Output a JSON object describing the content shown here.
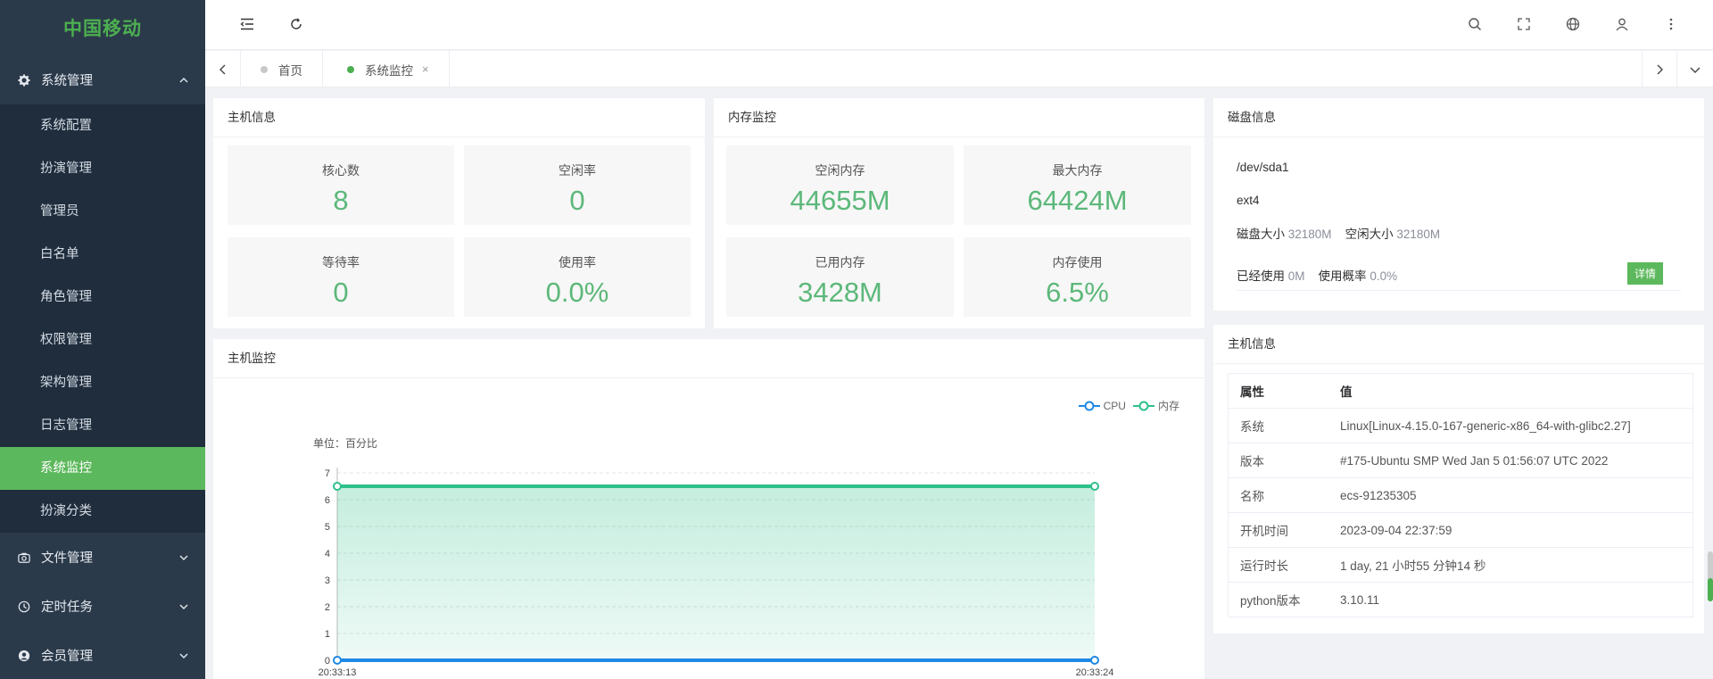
{
  "brand": {
    "logo_text": "中国移动",
    "accent": "#5cb85c",
    "sidebar_bg": "#1f2d3d"
  },
  "sidebar": {
    "groups": [
      {
        "label": "系统管理",
        "icon": "gear-icon",
        "expanded": true,
        "items": [
          {
            "label": "系统配置"
          },
          {
            "label": "扮演管理"
          },
          {
            "label": "管理员"
          },
          {
            "label": "白名单"
          },
          {
            "label": "角色管理"
          },
          {
            "label": "权限管理"
          },
          {
            "label": "架构管理"
          },
          {
            "label": "日志管理"
          },
          {
            "label": "系统监控",
            "active": true
          },
          {
            "label": "扮演分类"
          }
        ]
      },
      {
        "label": "文件管理",
        "icon": "camera-icon",
        "expanded": false
      },
      {
        "label": "定时任务",
        "icon": "clock-icon",
        "expanded": false
      },
      {
        "label": "会员管理",
        "icon": "user-circle-icon",
        "expanded": false
      }
    ]
  },
  "header": {
    "icons": [
      "menu-fold-icon",
      "refresh-icon",
      "search-icon",
      "fullscreen-icon",
      "globe-icon",
      "user-icon",
      "more-vertical-icon"
    ]
  },
  "tabs": [
    {
      "label": "首页",
      "active": false
    },
    {
      "label": "系统监控",
      "active": true,
      "closable": true,
      "close_glyph": "×"
    }
  ],
  "host_info": {
    "title": "主机信息",
    "stats": [
      {
        "label": "核心数",
        "value": "8"
      },
      {
        "label": "空闲率",
        "value": "0"
      },
      {
        "label": "等待率",
        "value": "0"
      },
      {
        "label": "使用率",
        "value": "0.0%"
      }
    ]
  },
  "memory": {
    "title": "内存监控",
    "stats": [
      {
        "label": "空闲内存",
        "value": "44655M"
      },
      {
        "label": "最大内存",
        "value": "64424M"
      },
      {
        "label": "已用内存",
        "value": "3428M"
      },
      {
        "label": "内存使用",
        "value": "6.5%"
      }
    ]
  },
  "disk": {
    "title": "磁盘信息",
    "device": "/dev/sda1",
    "fs": "ext4",
    "size_label": "磁盘大小",
    "size_value": "32180M",
    "free_label": "空闲大小",
    "free_value": "32180M",
    "used_label": "已经使用",
    "used_value": "0M",
    "usage_label": "使用概率",
    "usage_value": "0.0%",
    "detail_button": "详情"
  },
  "host_table": {
    "title": "主机信息",
    "headers": [
      "属性",
      "值"
    ],
    "rows": [
      [
        "系统",
        "Linux[Linux-4.15.0-167-generic-x86_64-with-glibc2.27]"
      ],
      [
        "版本",
        "#175-Ubuntu SMP Wed Jan 5 01:56:07 UTC 2022"
      ],
      [
        "名称",
        "ecs-91235305"
      ],
      [
        "开机时间",
        "2023-09-04 22:37:59"
      ],
      [
        "运行时长",
        "1 day, 21 小时55 分钟14 秒"
      ],
      [
        "python版本",
        "3.10.11"
      ]
    ]
  },
  "monitor": {
    "title": "主机监控"
  },
  "chart_data": {
    "type": "area",
    "title": "",
    "unit_label": "单位：百分比",
    "x": [
      "20:33:13",
      "20:33:24"
    ],
    "series": [
      {
        "name": "CPU",
        "values": [
          0,
          0
        ],
        "color": "#1e88e5"
      },
      {
        "name": "内存",
        "values": [
          6.5,
          6.5
        ],
        "color": "#2ec08a"
      }
    ],
    "ylim": [
      0,
      7
    ],
    "yticks": [
      0,
      1,
      2,
      3,
      4,
      5,
      6,
      7
    ],
    "grid": true,
    "legend": "top-right"
  }
}
